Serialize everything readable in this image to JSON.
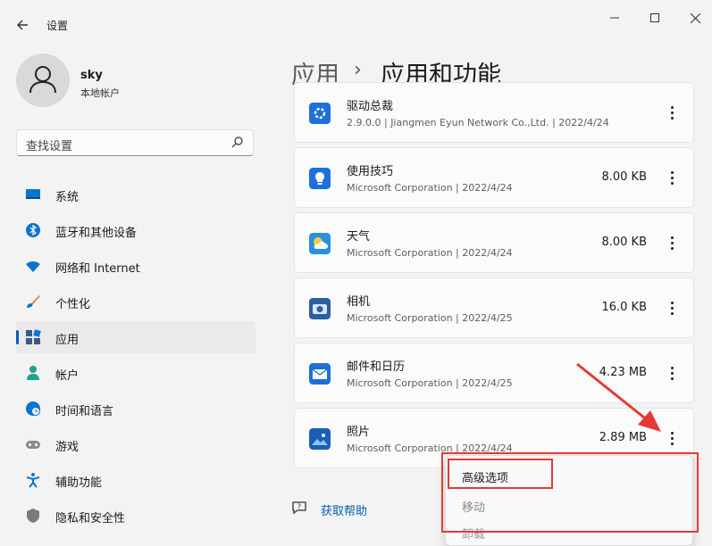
{
  "window": {
    "title": "设置"
  },
  "user": {
    "name": "sky",
    "account_type": "本地帐户"
  },
  "search": {
    "placeholder": "查找设置"
  },
  "nav": [
    {
      "label": "系统",
      "icon": "monitor-icon"
    },
    {
      "label": "蓝牙和其他设备",
      "icon": "bluetooth-icon"
    },
    {
      "label": "网络和 Internet",
      "icon": "wifi-icon"
    },
    {
      "label": "个性化",
      "icon": "brush-icon"
    },
    {
      "label": "应用",
      "icon": "apps-icon",
      "selected": true
    },
    {
      "label": "帐户",
      "icon": "person-icon"
    },
    {
      "label": "时间和语言",
      "icon": "globe-clock-icon"
    },
    {
      "label": "游戏",
      "icon": "gamepad-icon"
    },
    {
      "label": "辅助功能",
      "icon": "accessibility-icon"
    },
    {
      "label": "隐私和安全性",
      "icon": "shield-icon"
    }
  ],
  "breadcrumb": {
    "parent": "应用",
    "separator": "›",
    "current": "应用和功能"
  },
  "apps": [
    {
      "name": "驱动总裁",
      "version": "2.9.0.0",
      "publisher": "Jiangmen Eyun Network Co.,Ltd.",
      "date": "2022/4/24",
      "size": "",
      "icon": "gear-app-icon"
    },
    {
      "name": "使用技巧",
      "publisher": "Microsoft Corporation",
      "date": "2022/4/24",
      "size": "8.00 KB",
      "icon": "lightbulb-icon"
    },
    {
      "name": "天气",
      "publisher": "Microsoft Corporation",
      "date": "2022/4/24",
      "size": "8.00 KB",
      "icon": "weather-icon"
    },
    {
      "name": "相机",
      "publisher": "Microsoft Corporation",
      "date": "2022/4/25",
      "size": "16.0 KB",
      "icon": "camera-icon"
    },
    {
      "name": "邮件和日历",
      "publisher": "Microsoft Corporation",
      "date": "2022/4/25",
      "size": "4.23 MB",
      "icon": "mail-icon"
    },
    {
      "name": "照片",
      "publisher": "Microsoft Corporation",
      "date": "2022/4/24",
      "size": "2.89 MB",
      "icon": "photos-icon"
    }
  ],
  "help": {
    "label": "获取帮助"
  },
  "context_menu": {
    "items": [
      "高级选项",
      "移动",
      "卸载"
    ]
  },
  "colors": {
    "accent": "#005fb8",
    "annotation": "#e53935"
  }
}
